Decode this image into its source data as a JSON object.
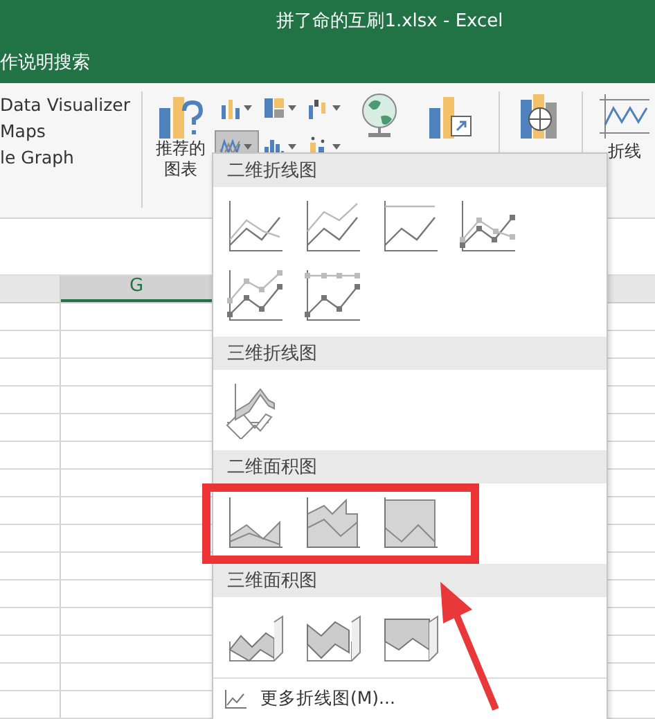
{
  "window": {
    "title": "拼了命的互刷1.xlsx  -  Excel"
  },
  "tell_me": {
    "text": "作说明搜索"
  },
  "ribbon": {
    "addins": [
      "Data Visualizer",
      "Maps",
      "le Graph"
    ],
    "recommended": {
      "label_lines": [
        "推荐的",
        "图表"
      ]
    },
    "chart_buttons": [
      {
        "kind": "column",
        "pressed": false
      },
      {
        "kind": "hierarchy",
        "pressed": false
      },
      {
        "kind": "waterfall",
        "pressed": false
      },
      {
        "kind": "line",
        "pressed": true
      },
      {
        "kind": "statistic",
        "pressed": false
      },
      {
        "kind": "scatter",
        "pressed": false
      }
    ],
    "sparkline": {
      "label": "折线"
    }
  },
  "sheet": {
    "column_header": {
      "label": "G",
      "selected": true
    }
  },
  "dropdown": {
    "sections": [
      {
        "title": "二维折线图",
        "highlighted": false,
        "items": [
          {
            "kind": "line"
          },
          {
            "kind": "stacked-line"
          },
          {
            "kind": "percent-line"
          },
          {
            "kind": "line-markers"
          },
          {
            "kind": "stacked-markers"
          },
          {
            "kind": "percent-markers"
          }
        ]
      },
      {
        "title": "三维折线图",
        "highlighted": false,
        "items": [
          {
            "kind": "line-3d"
          }
        ]
      },
      {
        "title": "二维面积图",
        "highlighted": true,
        "items": [
          {
            "kind": "area"
          },
          {
            "kind": "stacked-area"
          },
          {
            "kind": "percent-area"
          }
        ]
      },
      {
        "title": "三维面积图",
        "highlighted": false,
        "items": [
          {
            "kind": "area-3d"
          },
          {
            "kind": "stacked-area-3d"
          },
          {
            "kind": "percent-area-3d"
          }
        ]
      }
    ],
    "footer": {
      "label": "更多折线图(M)..."
    }
  }
}
